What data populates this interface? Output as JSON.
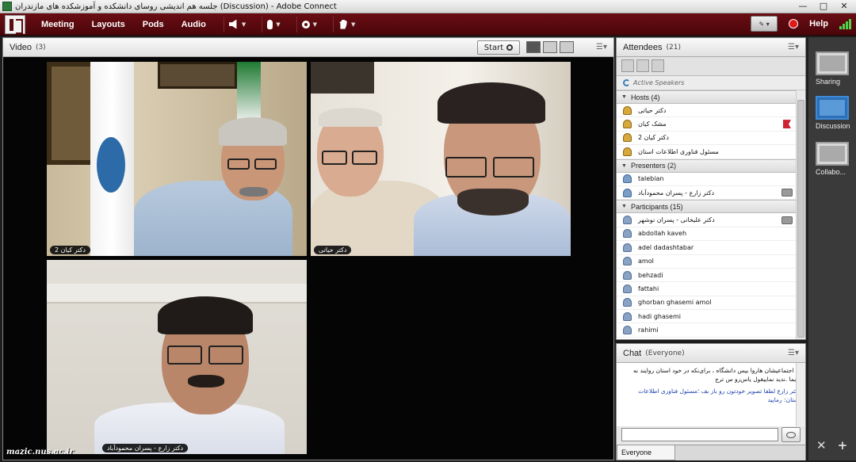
{
  "window": {
    "title": "جلسه هم اندیشی روسای دانشکده و آموزشکده های مازندران (Discussion) - Adobe Connect",
    "controls": [
      "—",
      "□",
      "✕"
    ]
  },
  "menubar": {
    "items": [
      "Meeting",
      "Layouts",
      "Pods",
      "Audio"
    ],
    "help": "Help",
    "colors": {
      "bar": "#5a0a10",
      "record": "#e01818",
      "signal": "#4fd34f"
    }
  },
  "video_pod": {
    "title": "Video",
    "count": "(3)",
    "start_label": "Start",
    "tiles": [
      {
        "name": "دکتر کیان 2"
      },
      {
        "name": "دکتر حیاتی"
      },
      {
        "name": "دکتر زارع - پسران محمودآباد"
      }
    ],
    "watermark": "mazic.nus.ac.ir"
  },
  "attendees": {
    "title": "Attendees",
    "count": "(21)",
    "active_speakers": "Active Speakers",
    "sections": {
      "hosts": {
        "label": "Hosts (4)",
        "rows": [
          "دکتر حیاتی",
          "مشک کیان",
          "دکتر کیان 2",
          "مسئول فناوری اطلاعات استان"
        ]
      },
      "presenters": {
        "label": "Presenters (2)",
        "rows": [
          "talebian",
          "دکتر زارع - پسران محمودآباد"
        ]
      },
      "participants": {
        "label": "Participants (15)",
        "rows": [
          "دکتر علیخانی - پسران نوشهر",
          "abdollah kaveh",
          "adel dadashtabar",
          "amol",
          "behzadi",
          "fattahi",
          "ghorban ghasemi amol",
          "hadi ghasemi",
          "rahimi"
        ]
      }
    }
  },
  "chat": {
    "title": "Chat",
    "scope": "(Everyone)",
    "messages": [
      "نه اجتماعیشان هاروا بیس دانشگاه ، برای‌نکه در خود استان روایند نه اویما .ندید نماییقول یاس‌رو س تر‌ج",
      "دکتر زارع لطفا تصویر خودتون رو باز بف ؛مسئول فناوری اطلاعات استان: رمایید"
    ],
    "target": "Everyone"
  },
  "layouts_panel": {
    "items": [
      "Sharing",
      "Discussion",
      "Collabo..."
    ],
    "selected": "Discussion"
  }
}
